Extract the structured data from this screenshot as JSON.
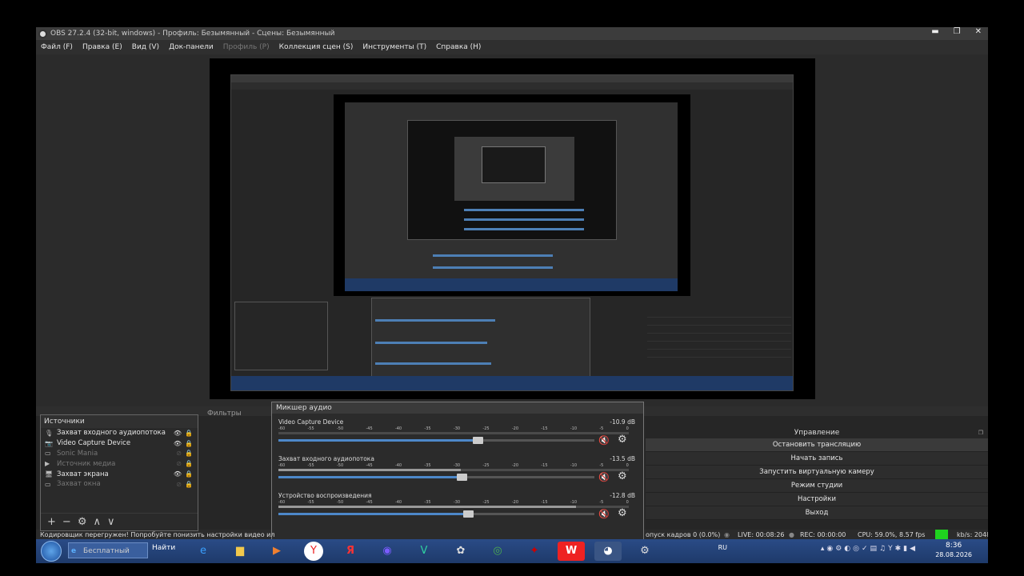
{
  "window": {
    "title": "OBS 27.2.4 (32-bit, windows) - Профиль: Безымянный - Сцены: Безымянный",
    "minimize": "▬",
    "maximize": "❐",
    "close": "✕"
  },
  "menu": [
    {
      "label": "Файл (F)",
      "enabled": true
    },
    {
      "label": "Правка (E)",
      "enabled": true
    },
    {
      "label": "Вид (V)",
      "enabled": true
    },
    {
      "label": "Док-панели",
      "enabled": true
    },
    {
      "label": "Профиль (P)",
      "enabled": false
    },
    {
      "label": "Коллекция сцен (S)",
      "enabled": true
    },
    {
      "label": "Инструменты (T)",
      "enabled": true
    },
    {
      "label": "Справка (H)",
      "enabled": true
    }
  ],
  "filters_tab": "Фильтры",
  "sources": {
    "title": "Источники",
    "items": [
      {
        "icon": "🎙",
        "label": "Захват входного аудиопотока",
        "visible": true
      },
      {
        "icon": "📷",
        "label": "Video Capture Device",
        "visible": true
      },
      {
        "icon": "▭",
        "label": "Sonic Mania",
        "visible": false
      },
      {
        "icon": "▶",
        "label": "Источник медиа",
        "visible": false
      },
      {
        "icon": "🖥",
        "label": "Захват экрана",
        "visible": true
      },
      {
        "icon": "▭",
        "label": "Захват окна",
        "visible": false
      }
    ],
    "toolbar": [
      "+",
      "−",
      "⚙",
      "∧",
      "∨"
    ]
  },
  "mixer": {
    "title": "Микшер аудио",
    "ticks": [
      "-60",
      "-55",
      "-50",
      "-45",
      "-40",
      "-35",
      "-30",
      "-25",
      "-20",
      "-15",
      "-10",
      "-5",
      "0"
    ],
    "channels": [
      {
        "name": "Video Capture Device",
        "db": "-10.9 dB",
        "level": 0.0,
        "volume": 0.63
      },
      {
        "name": "Захват входного аудиопотока",
        "db": "-13.5 dB",
        "level": 0.52,
        "volume": 0.58
      },
      {
        "name": "Устройство воспроизведения",
        "db": "-12.8 dB",
        "level": 0.85,
        "volume": 0.6
      }
    ]
  },
  "controls": {
    "title": "Управление",
    "buttons": [
      {
        "label": "Остановить трансляцию",
        "active": true
      },
      {
        "label": "Начать запись",
        "active": false
      },
      {
        "label": "Запустить виртуальную камеру",
        "active": false
      },
      {
        "label": "Режим студии",
        "active": false
      },
      {
        "label": "Настройки",
        "active": false
      },
      {
        "label": "Выход",
        "active": false
      }
    ]
  },
  "status": {
    "warning": "Кодировщик перегружен! Попробуйте понизить настройки видео ил",
    "dropped": "опуск кадров 0 (0.0%)",
    "live": "LIVE: 00:08:26",
    "rec": "REC: 00:00:00",
    "cpu": "CPU: 59.0%, 8.57 fps",
    "kbs": "kb/s: 2048"
  },
  "taskbar": {
    "search_text": "Бесплатный арх...",
    "find_label": "Найти",
    "lang": "RU",
    "time": "8:36",
    "date": "28.08.2026"
  }
}
